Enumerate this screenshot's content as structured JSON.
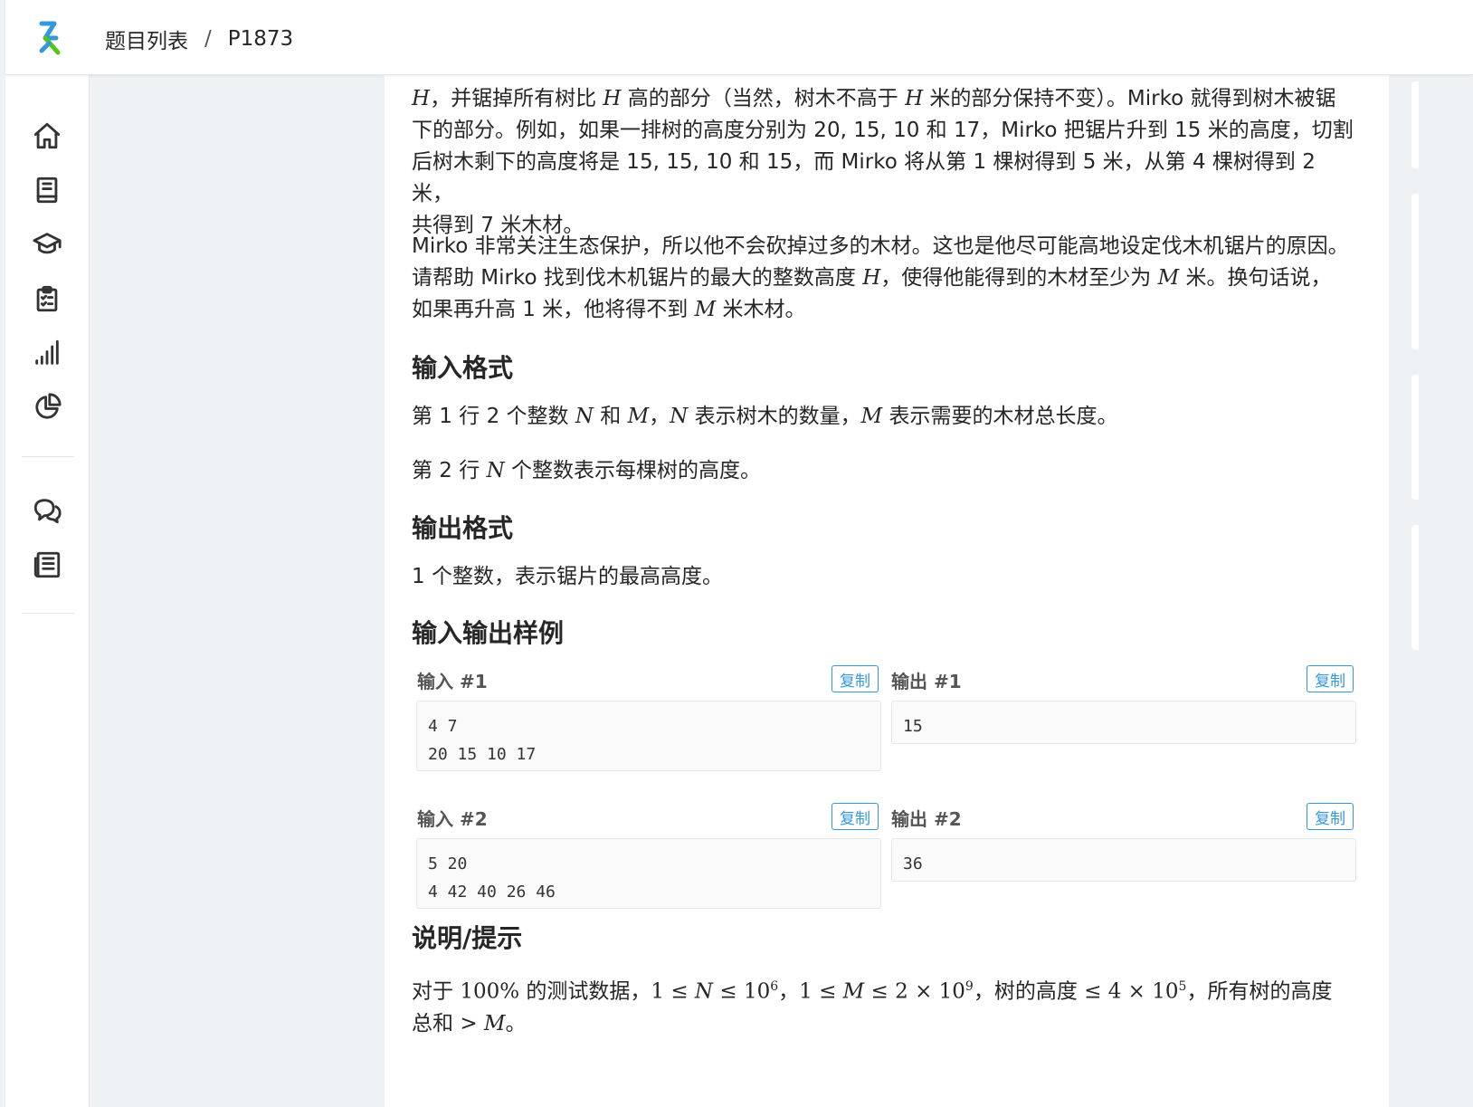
{
  "header": {
    "breadcrumb_root": "题目列表",
    "breadcrumb_sep": "/",
    "breadcrumb_current": "P1873"
  },
  "sidebar": {
    "icons": [
      "home-icon",
      "book-icon",
      "graduation-cap-icon",
      "clipboard-icon",
      "bar-chart-icon",
      "pie-chart-icon",
      "chat-icon",
      "news-icon"
    ]
  },
  "description": {
    "p1_line1": [
      "H",
      "，并锯掉所有树比 ",
      "H",
      " 高的部分（当然，树木不高于 ",
      "H",
      " 米的部分保持不变）。Mirko 就得到树木被锯"
    ],
    "p1_line2": "下的部分。例如，如果一排树的高度分别为 20, 15, 10 和 17，Mirko 把锯片升到 15 米的高度，切割",
    "p1_line3": "后树木剩下的高度将是 15, 15, 10 和 15，而 Mirko 将从第 1 棵树得到 5 米，从第 4 棵树得到 2 米，",
    "p1_line4": "共得到 7 米木材。",
    "p2_line1": "Mirko 非常关注生态保护，所以他不会砍掉过多的木材。这也是他尽可能高地设定伐木机锯片的原因。",
    "p2_line2": [
      "请帮助 Mirko 找到伐木机锯片的最大的整数高度 ",
      "H",
      "，使得他能得到的木材至少为 ",
      "M",
      " 米。换句话说，"
    ],
    "p2_line3": [
      "如果再升高 1 米，他将得不到 ",
      "M",
      " 米木材。"
    ]
  },
  "input_format": {
    "title": "输入格式",
    "line1": [
      "第 1 行 2 个整数 ",
      "N",
      " 和 ",
      "M",
      "，",
      "N",
      " 表示树木的数量，",
      "M",
      " 表示需要的木材总长度。"
    ],
    "line2": [
      "第 2 行 ",
      "N",
      " 个整数表示每棵树的高度。"
    ]
  },
  "output_format": {
    "title": "输出格式",
    "line1": "1 个整数，表示锯片的最高高度。"
  },
  "samples": {
    "title": "输入输出样例",
    "copy_label": "复制",
    "items": [
      {
        "in_label": "输入 #1",
        "out_label": "输出 #1",
        "input": "4 7\n20 15 10 17",
        "output": "15"
      },
      {
        "in_label": "输入 #2",
        "out_label": "输出 #2",
        "input": "5 20\n4 42 40 26 46",
        "output": "36"
      }
    ]
  },
  "hint": {
    "title": "说明/提示",
    "line1_a": "对于 ",
    "line1_b": "100%",
    "line1_c": " 的测试数据，",
    "line1_d": "1 ≤ ",
    "line1_e": "N",
    "line1_f": " ≤ 10",
    "line1_g": "6",
    "line1_h": "，",
    "line1_i": "1 ≤ ",
    "line1_j": "M",
    "line1_k": " ≤ 2 × 10",
    "line1_l": "9",
    "line1_m": "，树的高度 ",
    "line1_n": "≤ 4 × 10",
    "line1_o": "5",
    "line1_p": "，所有树的高度",
    "line2_a": "总和 ",
    "line2_b": "> ",
    "line2_c": "M",
    "line2_d": "。"
  }
}
